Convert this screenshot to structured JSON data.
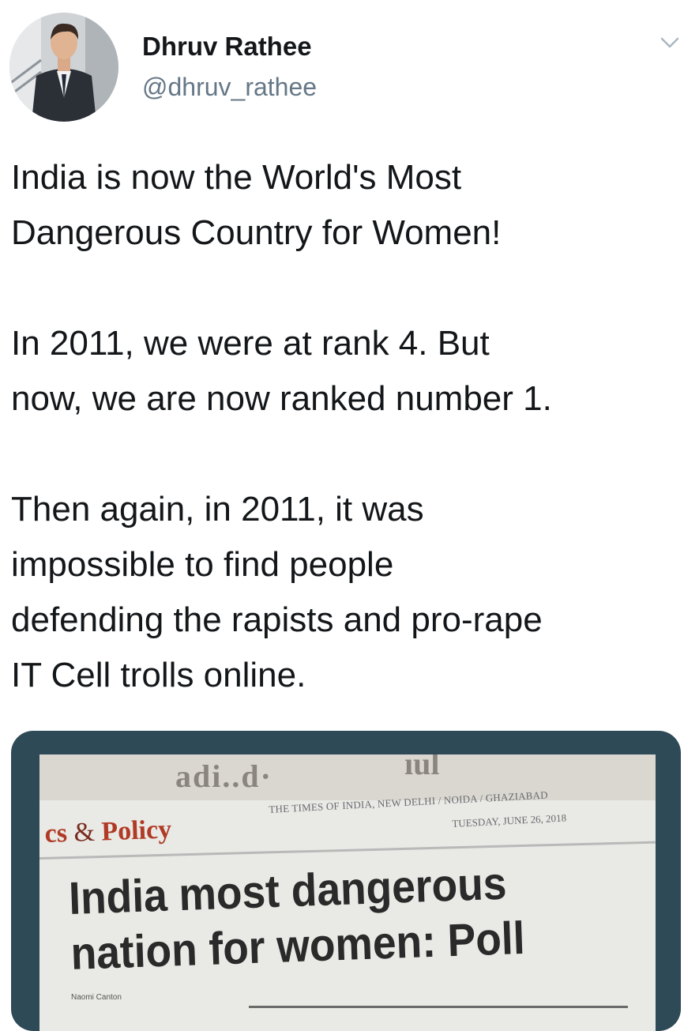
{
  "tweet": {
    "author": {
      "display_name": "Dhruv Rathee",
      "handle": "@dhruv_rathee"
    },
    "menu_icon": "chevron-down-icon",
    "paragraphs": [
      [
        "India is now the World's Most",
        "Dangerous Country for Women!"
      ],
      [
        "In 2011, we were at rank 4. But",
        "now, we are now ranked number 1."
      ],
      [
        "Then again, in 2011, it was",
        "impossible to find people",
        "defending the rapists and pro-rape",
        "IT Cell trolls online."
      ]
    ]
  },
  "media": {
    "newspaper": {
      "torn_header": "adi..d·",
      "torn_header_right": "ıul",
      "section": "cs",
      "section_amp": "&",
      "section_rest": "Policy",
      "publication": "THE TIMES OF INDIA, NEW DELHI / NOIDA / GHAZIABAD",
      "date": "TUESDAY, JUNE 26, 2018",
      "headline_line1": "India most dangerous",
      "headline_line2": "nation for women: Poll",
      "byline": "Naomi Canton"
    }
  },
  "colors": {
    "text": "#14171a",
    "secondary": "#657786",
    "media_frame": "#2f4a57",
    "section_red": "#b03a25"
  }
}
